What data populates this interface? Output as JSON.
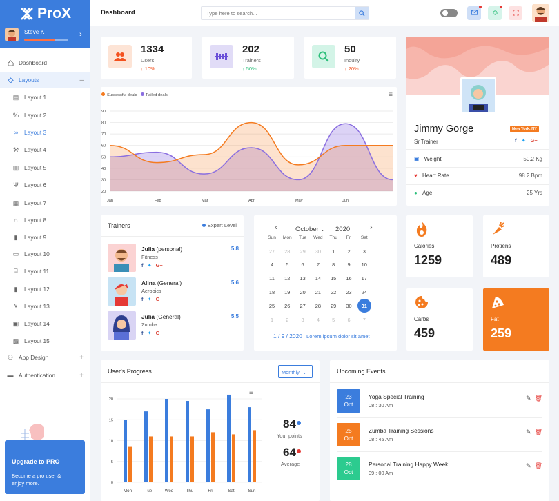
{
  "brand": {
    "name": "ProX"
  },
  "user": {
    "name": "Steve K"
  },
  "sidebar": {
    "items": [
      {
        "label": "Dashboard",
        "icon": "home-icon"
      },
      {
        "label": "Layouts",
        "icon": "diamond-icon"
      },
      {
        "label": "Layout 1",
        "icon": "layers-icon"
      },
      {
        "label": "Layout 2",
        "icon": "percent-icon"
      },
      {
        "label": "Layout 3",
        "icon": "link-icon"
      },
      {
        "label": "Layout 4",
        "icon": "wrench-icon"
      },
      {
        "label": "Layout 5",
        "icon": "bar-chart-icon"
      },
      {
        "label": "Layout 6",
        "icon": "cutlery-icon"
      },
      {
        "label": "Layout 7",
        "icon": "calendar-icon"
      },
      {
        "label": "Layout 8",
        "icon": "house-icon"
      },
      {
        "label": "Layout 9",
        "icon": "chart-icon"
      },
      {
        "label": "Layout 10",
        "icon": "card-icon"
      },
      {
        "label": "Layout 11",
        "icon": "bank-icon"
      },
      {
        "label": "Layout 12",
        "icon": "chart-icon"
      },
      {
        "label": "Layout 13",
        "icon": "cart-icon"
      },
      {
        "label": "Layout 14",
        "icon": "box-icon"
      },
      {
        "label": "Layout 15",
        "icon": "grid-icon"
      },
      {
        "label": "App Design",
        "icon": "apps-icon"
      },
      {
        "label": "Authentication",
        "icon": "id-card-icon"
      }
    ]
  },
  "upgrade": {
    "title": "Upgrade to PRO",
    "text": "Become a pro user & enjoy more."
  },
  "header": {
    "title": "Dashboard",
    "search_placeholder": "Type here to search..."
  },
  "stats": [
    {
      "value": "1334",
      "label": "Users",
      "change": "↓ 10%",
      "color": "#f4511e"
    },
    {
      "value": "202",
      "label": "Trainers",
      "change": "↑ 50%",
      "color": "#2bbf7a"
    },
    {
      "value": "50",
      "label": "Inquiry",
      "change": "↓ 20%",
      "color": "#f4511e"
    }
  ],
  "deals_chart": {
    "legend": [
      "Successful deals",
      "Failed deals"
    ],
    "y_ticks": [
      "90",
      "80",
      "70",
      "60",
      "50",
      "40",
      "30",
      "20"
    ],
    "x_ticks": [
      "Jan",
      "Feb",
      "Mar",
      "Apr",
      "May",
      "Jun"
    ]
  },
  "chart_data": [
    {
      "type": "area",
      "title": "",
      "legend": [
        "Successful deals",
        "Failed deals"
      ],
      "x": [
        "Jan",
        "Feb",
        "Mar",
        "Apr",
        "May",
        "Jun"
      ],
      "ylim": [
        20,
        90
      ],
      "series": [
        {
          "name": "Successful deals",
          "color": "#f47b20",
          "values": [
            60,
            45,
            52,
            80,
            43,
            60,
            60
          ]
        },
        {
          "name": "Failed deals",
          "color": "#8a6ee0",
          "values": [
            50,
            54,
            35,
            58,
            30,
            79,
            30
          ]
        }
      ]
    },
    {
      "type": "bar",
      "title": "",
      "categories": [
        "Mon",
        "Tue",
        "Wed",
        "Thu",
        "Fri",
        "Sat",
        "Sun"
      ],
      "ylim": [
        0,
        20
      ],
      "series": [
        {
          "name": "Your points",
          "color": "#3b7ddd",
          "values": [
            15,
            17,
            20,
            19.5,
            17.5,
            21,
            18
          ]
        },
        {
          "name": "Average",
          "color": "#f47b20",
          "values": [
            8.5,
            11,
            11,
            11,
            12,
            11.5,
            12.5
          ]
        }
      ]
    }
  ],
  "profile": {
    "name": "Jimmy Gorge",
    "role": "Sr.Trainer",
    "location": "New York, NY",
    "rows": [
      {
        "label": "Weight",
        "value": "50.2 Kg"
      },
      {
        "label": "Heart Rate",
        "value": "98.2 Bpm"
      },
      {
        "label": "Age",
        "value": "25 Yrs"
      }
    ]
  },
  "trainers": {
    "title": "Trainers",
    "legend": "Expert Level",
    "items": [
      {
        "name": "Julia",
        "type": "(personal)",
        "sport": "Fitness",
        "level": "5.8"
      },
      {
        "name": "Alina",
        "type": "(General)",
        "sport": "Aerobics",
        "level": "5.6"
      },
      {
        "name": "Julia",
        "type": "(General)",
        "sport": "Zumba",
        "level": "5.5"
      }
    ]
  },
  "calendar": {
    "month": "October",
    "year": "2020",
    "days": [
      "Sun",
      "Mon",
      "Tue",
      "Wed",
      "Thu",
      "Fri",
      "Sat"
    ],
    "rows": [
      [
        "27",
        "28",
        "29",
        "30",
        "1",
        "2",
        "3"
      ],
      [
        "4",
        "5",
        "6",
        "7",
        "8",
        "9",
        "10"
      ],
      [
        "11",
        "12",
        "13",
        "14",
        "15",
        "16",
        "17"
      ],
      [
        "18",
        "19",
        "20",
        "21",
        "22",
        "23",
        "24"
      ],
      [
        "25",
        "26",
        "27",
        "28",
        "29",
        "30",
        "31"
      ],
      [
        "1",
        "2",
        "3",
        "4",
        "5",
        "6",
        "7"
      ]
    ],
    "footer_date": "1 / 9 / 2020",
    "footer_text": "Lorem ipsum dolor sit amet"
  },
  "fitness": [
    {
      "label": "Calories",
      "value": "1259"
    },
    {
      "label": "Protiens",
      "value": "489"
    },
    {
      "label": "Carbs",
      "value": "459"
    },
    {
      "label": "Fat",
      "value": "259"
    }
  ],
  "progress": {
    "title": "User's Progress",
    "select": "Monthly",
    "y_ticks": [
      "20",
      "15",
      "10",
      "5",
      "0"
    ],
    "your_points": "84",
    "your_points_label": "Your points",
    "average": "64",
    "average_label": "Average"
  },
  "events": {
    "title": "Upcoming Events",
    "items": [
      {
        "day": "23",
        "month": "Oct",
        "title": "Yoga Special Training",
        "time": "08 : 30 Am",
        "color": "#3b7ddd"
      },
      {
        "day": "25",
        "month": "Oct",
        "title": "Zumba Training Sessions",
        "time": "08 : 45 Am",
        "color": "#f47b20"
      },
      {
        "day": "28",
        "month": "Oct",
        "title": "Personal Training Happy Week",
        "time": "09 : 00 Am",
        "color": "#2ccb8f"
      }
    ]
  }
}
